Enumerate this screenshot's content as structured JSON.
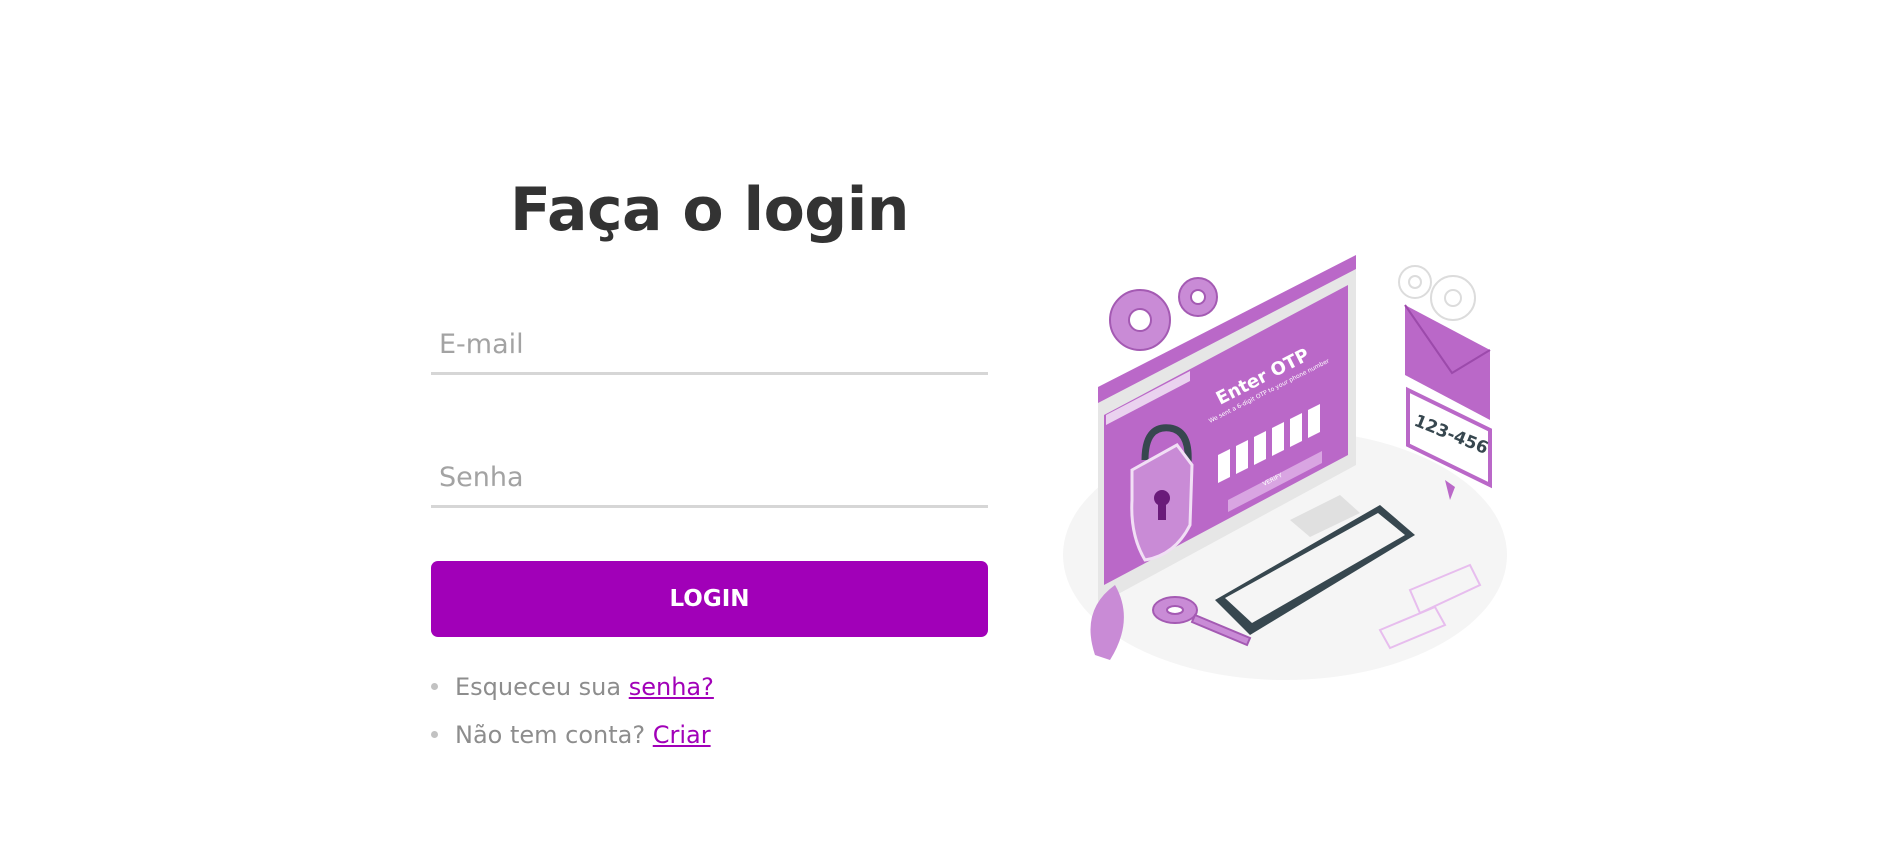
{
  "login": {
    "title": "Faça o login",
    "email_placeholder": "E-mail",
    "password_placeholder": "Senha",
    "button_label": "LOGIN",
    "forgot_text": "Esqueceu sua ",
    "forgot_link": "senha?",
    "signup_text": "Não tem conta? ",
    "signup_link": "Criar"
  },
  "illustration": {
    "heading": "Enter OTP",
    "subtext": "We sent a 6-digit OTP to your phone number",
    "verify_label": "VERIFY",
    "code": "123-456",
    "icon": "otp-security-illustration"
  },
  "colors": {
    "accent": "#a100b8",
    "illustration_purple": "#ba68c8",
    "title": "#333333",
    "muted": "#8d8d8d"
  }
}
